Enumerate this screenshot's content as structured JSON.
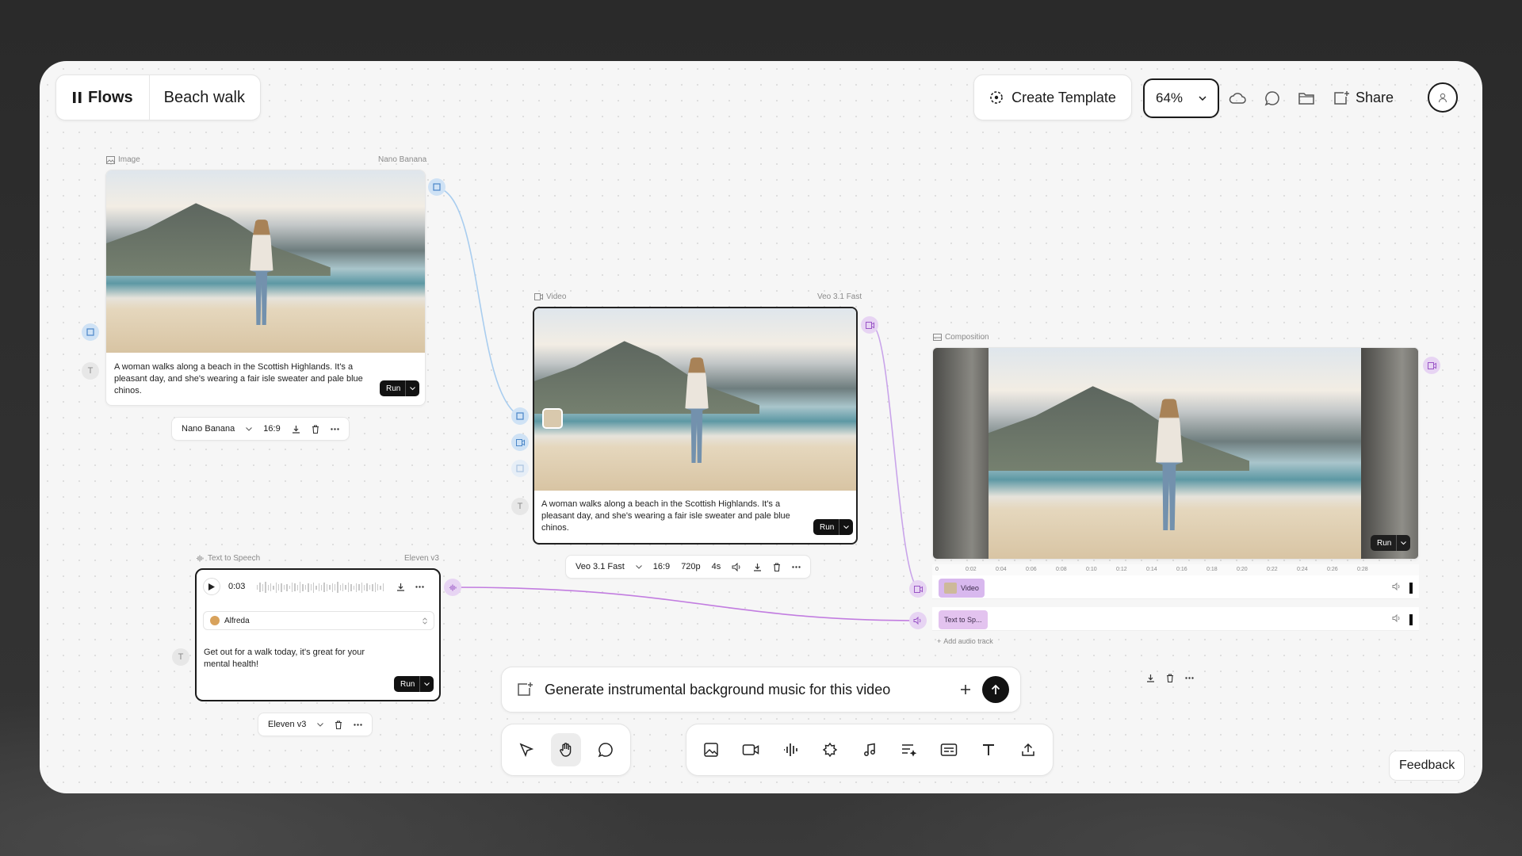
{
  "header": {
    "brand": "Flows",
    "project": "Beach walk",
    "create_template": "Create Template",
    "zoom": "64%",
    "share": "Share"
  },
  "image_node": {
    "type_label": "Image",
    "model_label": "Nano Banana",
    "prompt": "A woman walks along a beach in the Scottish Highlands. It's a pleasant day, and she's wearing a fair isle sweater and pale blue chinos.",
    "run": "Run",
    "bar": {
      "model": "Nano Banana",
      "ratio": "16:9"
    }
  },
  "video_node": {
    "type_label": "Video",
    "model_label": "Veo 3.1 Fast",
    "prompt": "A woman walks along a beach in the Scottish Highlands. It's a pleasant day, and she's wearing a fair isle sweater and pale blue chinos.",
    "run": "Run",
    "bar": {
      "model": "Veo 3.1 Fast",
      "ratio": "16:9",
      "resolution": "720p",
      "duration": "4s"
    }
  },
  "tts_node": {
    "type_label": "Text to Speech",
    "model_label": "Eleven v3",
    "time": "0:03",
    "voice": "Alfreda",
    "prompt": "Get out for a walk today, it's great for your mental health!",
    "run": "Run",
    "bar": {
      "model": "Eleven v3"
    }
  },
  "composition_node": {
    "type_label": "Composition",
    "run": "Run",
    "ruler": [
      "0",
      "0:02",
      "0:04",
      "0:06",
      "0:08",
      "0:10",
      "0:12",
      "0:14",
      "0:16",
      "0:18",
      "0:20",
      "0:22",
      "0:24",
      "0:26",
      "0:28"
    ],
    "tracks": [
      {
        "label": "Video"
      },
      {
        "label": "Text to Sp..."
      }
    ],
    "add_audio": "Add audio track"
  },
  "prompt_bar": {
    "text": "Generate instrumental background music for this video"
  },
  "feedback": "Feedback",
  "colors": {
    "accent_blue": "#9cc4ea",
    "accent_purple": "#c27de0",
    "dark": "#121212"
  }
}
